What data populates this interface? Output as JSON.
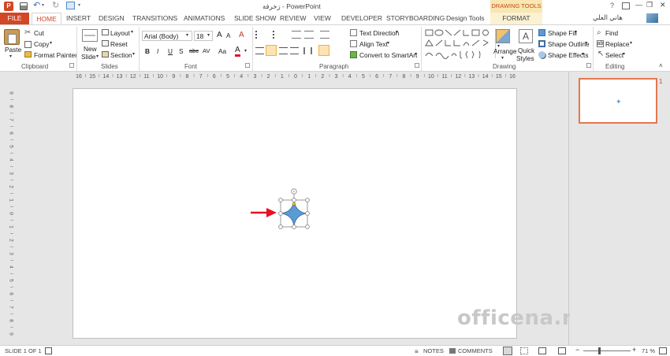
{
  "window": {
    "title": "زخرفة - PowerPoint",
    "user": "هاني العلي",
    "min_glyph": "—",
    "restore_glyph": "❐",
    "close_glyph": "✕",
    "help_glyph": "?"
  },
  "tabs": {
    "file": "FILE",
    "home": "HOME",
    "insert": "INSERT",
    "design": "DESIGN",
    "transitions": "TRANSITIONS",
    "animations": "ANIMATIONS",
    "slideshow": "SLIDE SHOW",
    "review": "REVIEW",
    "view": "VIEW",
    "developer": "DEVELOPER",
    "storyboarding": "STORYBOARDING",
    "designtools": "Design Tools",
    "drawing_tools": "DRAWING TOOLS",
    "format": "FORMAT"
  },
  "ribbon": {
    "clipboard": {
      "paste": "Paste",
      "cut": "Cut",
      "copy": "Copy",
      "format_painter": "Format Painter",
      "label": "Clipboard"
    },
    "slides": {
      "new_slide_1": "New",
      "new_slide_2": "Slide",
      "layout": "Layout",
      "reset": "Reset",
      "section": "Section",
      "label": "Slides"
    },
    "font": {
      "name": "Arial (Body)",
      "size": "18",
      "grow": "A",
      "shrink": "A",
      "clear": "A",
      "bold": "B",
      "italic": "I",
      "underline": "U",
      "strike": "S",
      "shadow": "abc",
      "spacing": "AV",
      "case": "Aa",
      "color": "A",
      "label": "Font"
    },
    "paragraph": {
      "text_direction": "Text Direction",
      "align_text": "Align Text",
      "smartart": "Convert to SmartArt",
      "label": "Paragraph"
    },
    "drawing": {
      "arrange": "Arrange",
      "quick_1": "Quick",
      "quick_2": "Styles",
      "fill": "Shape Fill",
      "outline": "Shape Outline",
      "effects": "Shape Effects",
      "label": "Drawing"
    },
    "editing": {
      "find": "Find",
      "replace": "Replace",
      "select": "Select",
      "label": "Editing"
    }
  },
  "rulers": {
    "horizontal": [
      "16",
      "15",
      "14",
      "13",
      "12",
      "11",
      "10",
      "9",
      "8",
      "7",
      "6",
      "5",
      "4",
      "3",
      "2",
      "1",
      "0",
      "1",
      "2",
      "3",
      "4",
      "5",
      "6",
      "7",
      "8",
      "9",
      "10",
      "11",
      "12",
      "13",
      "14",
      "15",
      "16"
    ],
    "vertical": [
      "9",
      "8",
      "7",
      "6",
      "5",
      "4",
      "3",
      "2",
      "1",
      "0",
      "1",
      "2",
      "3",
      "4",
      "5",
      "6",
      "7",
      "8",
      "9"
    ]
  },
  "thumbnail": {
    "number": "1"
  },
  "watermark": "officena.net",
  "status": {
    "slide": "SLIDE 1 OF 1",
    "notes": "NOTES",
    "comments": "COMMENTS",
    "zoom": "71 %",
    "zoom_level": 0.71
  },
  "colors": {
    "accent": "#d24726",
    "shape_fill": "#5b9bd5",
    "arrow": "#e81123",
    "contextual": "#f8e7b0"
  }
}
